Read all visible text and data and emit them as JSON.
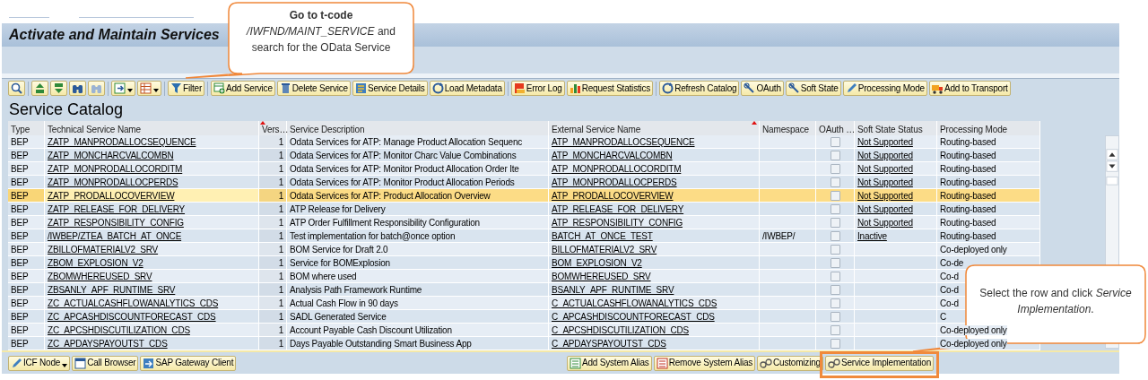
{
  "window": {
    "title": "Activate and Maintain Services"
  },
  "toolbar": [
    {
      "menu": false,
      "separator_before": false
    },
    {
      "menu": false,
      "separator_before": true
    },
    {
      "menu": false,
      "separator_before": false
    },
    {
      "menu": false,
      "separator_before": false
    },
    {
      "menu": false,
      "separator_before": false
    },
    {
      "menu": true,
      "separator_before": true
    },
    {
      "menu": true,
      "separator_before": false
    },
    {
      "label": "Filter",
      "menu": false,
      "separator_before": true
    },
    {
      "label": "Add Service",
      "menu": false,
      "separator_before": true
    },
    {
      "label": "Delete Service",
      "menu": false,
      "separator_before": false
    },
    {
      "label": "Service Details",
      "menu": false,
      "separator_before": false
    },
    {
      "label": "Load Metadata",
      "menu": false,
      "separator_before": false
    },
    {
      "label": "Error Log",
      "menu": false,
      "separator_before": true
    },
    {
      "label": "Request Statistics",
      "menu": false,
      "separator_before": false
    },
    {
      "label": "Refresh Catalog",
      "menu": false,
      "separator_before": true
    },
    {
      "label": "OAuth",
      "menu": false,
      "separator_before": false
    },
    {
      "label": "Soft State",
      "menu": false,
      "separator_before": false
    },
    {
      "label": "Processing Mode",
      "menu": false,
      "separator_before": false
    },
    {
      "label": "Add to Transport",
      "menu": false,
      "separator_before": false
    }
  ],
  "catalog": {
    "title": "Service Catalog",
    "columns": [
      {
        "label": "Type",
        "sort_marked": false
      },
      {
        "label": "Technical Service Name",
        "sort_marked": false
      },
      {
        "label": "Vers…",
        "sort_marked": true
      },
      {
        "label": "Service Description",
        "sort_marked": false
      },
      {
        "label": "External Service Name",
        "sort_marked": true
      },
      {
        "label": "Namespace",
        "sort_marked": false
      },
      {
        "label": "OAuth …",
        "sort_marked": false
      },
      {
        "label": "Soft State Status",
        "sort_marked": false
      },
      {
        "label": "Processing Mode",
        "sort_marked": false
      }
    ],
    "rows": [
      {
        "type": "BEP",
        "technical_name": "ZATP_MANPRODALLOCSEQUENCE",
        "version": "1",
        "description": "Odata Services for ATP: Manage Product Allocation Sequenc",
        "external_name": "ATP_MANPRODALLOCSEQUENCE",
        "oauth": false,
        "soft_state": "Not Supported",
        "processing_mode": "Routing-based",
        "selected": false
      },
      {
        "type": "BEP",
        "technical_name": "ZATP_MONCHARCVALCOMBN",
        "version": "1",
        "description": "Odata Services for ATP: Monitor Charc Value Combinations",
        "external_name": "ATP_MONCHARCVALCOMBN",
        "oauth": false,
        "soft_state": "Not Supported",
        "processing_mode": "Routing-based",
        "selected": false
      },
      {
        "type": "BEP",
        "technical_name": "ZATP_MONPRODALLOCORDITM",
        "version": "1",
        "description": "Odata Services for ATP: Monitor Product Allocation Order Ite",
        "external_name": "ATP_MONPRODALLOCORDITM",
        "oauth": false,
        "soft_state": "Not Supported",
        "processing_mode": "Routing-based",
        "selected": false
      },
      {
        "type": "BEP",
        "technical_name": "ZATP_MONPRODALLOCPERDS",
        "version": "1",
        "description": "Odata Services for ATP: Monitor Product Allocation Periods",
        "external_name": "ATP_MONPRODALLOCPERDS",
        "oauth": false,
        "soft_state": "Not Supported",
        "processing_mode": "Routing-based",
        "selected": false
      },
      {
        "type": "BEP",
        "technical_name": "ZATP_PRODALLOCOVERVIEW",
        "version": "1",
        "description": "Odata Services for ATP: Product Allocation Overview",
        "external_name": "ATP_PRODALLOCOVERVIEW",
        "oauth": false,
        "soft_state": "Not Supported",
        "processing_mode": "Routing-based",
        "selected": true
      },
      {
        "type": "BEP",
        "technical_name": "ZATP_RELEASE_FOR_DELIVERY",
        "version": "1",
        "description": "ATP Release for Delivery",
        "external_name": "ATP_RELEASE_FOR_DELIVERY",
        "oauth": false,
        "soft_state": "Not Supported",
        "processing_mode": "Routing-based",
        "selected": false
      },
      {
        "type": "BEP",
        "technical_name": "ZATP_RESPONSIBILITY_CONFIG",
        "version": "1",
        "description": "ATP Order Fulfillment Responsibility Configuration",
        "external_name": "ATP_RESPONSIBILITY_CONFIG",
        "oauth": false,
        "soft_state": "Not Supported",
        "processing_mode": "Routing-based",
        "selected": false
      },
      {
        "type": "BEP",
        "technical_name": "/IWBEP/ZTEA_BATCH_AT_ONCE",
        "version": "1",
        "description": "Test implementation for batch@once option",
        "external_name": "BATCH_AT_ONCE_TEST",
        "namespace": "/IWBEP/",
        "oauth": false,
        "soft_state": "Inactive",
        "processing_mode": "Routing-based",
        "selected": false
      },
      {
        "type": "BEP",
        "technical_name": "ZBILLOFMATERIALV2_SRV",
        "version": "1",
        "description": "BOM Service for Draft 2.0",
        "external_name": "BILLOFMATERIALV2_SRV",
        "oauth": false,
        "processing_mode": "Co-deployed only",
        "selected": false
      },
      {
        "type": "BEP",
        "technical_name": "ZBOM_EXPLOSION_V2",
        "version": "1",
        "description": "Service for BOMExplosion",
        "external_name": "BOM_EXPLOSION_V2",
        "oauth": false,
        "processing_mode": "Co-de",
        "selected": false
      },
      {
        "type": "BEP",
        "technical_name": "ZBOMWHEREUSED_SRV",
        "version": "1",
        "description": "BOM where used",
        "external_name": "BOMWHEREUSED_SRV",
        "oauth": false,
        "processing_mode": "Co-d",
        "selected": false
      },
      {
        "type": "BEP",
        "technical_name": "ZBSANLY_APF_RUNTIME_SRV",
        "version": "1",
        "description": "Analysis Path Framework Runtime",
        "external_name": "BSANLY_APF_RUNTIME_SRV",
        "oauth": false,
        "processing_mode": "Co-d",
        "selected": false
      },
      {
        "type": "BEP",
        "technical_name": "ZC_ACTUALCASHFLOWANALYTICS_CDS",
        "version": "1",
        "description": "Actual Cash Flow in 90 days",
        "external_name": "C_ACTUALCASHFLOWANALYTICS_CDS",
        "oauth": false,
        "processing_mode": "Co-d",
        "selected": false
      },
      {
        "type": "BEP",
        "technical_name": "ZC_APCASHDISCOUNTFORECAST_CDS",
        "version": "1",
        "description": "SADL Generated Service",
        "external_name": "C_APCASHDISCOUNTFORECAST_CDS",
        "oauth": false,
        "processing_mode": "C",
        "selected": false
      },
      {
        "type": "BEP",
        "technical_name": "ZC_APCSHDISCUTILIZATION_CDS",
        "version": "1",
        "description": "Account Payable Cash Discount Utilization",
        "external_name": "C_APCSHDISCUTILIZATION_CDS",
        "oauth": false,
        "processing_mode": "Co-deployed only",
        "selected": false
      },
      {
        "type": "BEP",
        "technical_name": "ZC_APDAYSPAYOUTST_CDS",
        "version": "1",
        "description": "Days Payable Outstanding Smart Business App",
        "external_name": "C_APDAYSPAYOUTST_CDS",
        "oauth": false,
        "processing_mode": "Co-deployed only",
        "selected": false
      }
    ]
  },
  "bottom_left": [
    {
      "label": "ICF Node",
      "menu": true
    },
    {
      "label": "Call Browser",
      "menu": false
    },
    {
      "label": "SAP Gateway Client",
      "menu": false
    }
  ],
  "bottom_right": [
    {
      "label": "Add System Alias",
      "menu": false,
      "highlighted": false
    },
    {
      "label": "Remove System Alias",
      "menu": false,
      "highlighted": false
    },
    {
      "label": "Customizing",
      "menu": false,
      "highlighted": false
    },
    {
      "label": "Service Implementation",
      "menu": false,
      "highlighted": true
    }
  ],
  "callouts": [
    {
      "text": "**Go to t-code**\n*/IWFND/MAINT_SERVICE* and\nsearch for the OData Service"
    },
    {
      "text": "Select the row and click *Service\nImplementation*."
    }
  ]
}
